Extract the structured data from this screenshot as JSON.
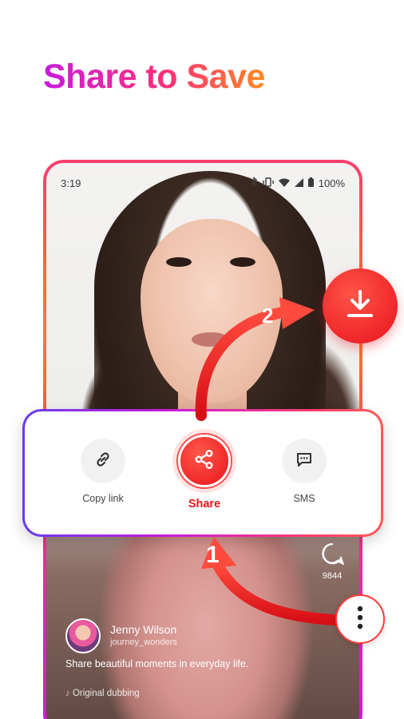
{
  "headline": "Share to Save",
  "status_bar": {
    "time": "3:19",
    "battery": "100%",
    "icons": [
      "bluetooth-icon",
      "vibrate-icon",
      "wifi-icon",
      "signal-icon",
      "battery-icon"
    ]
  },
  "video": {
    "comment_count": "9844",
    "user_name": "Jenny Wilson",
    "user_handle": "journey_wonders",
    "caption": "Share beautiful moments in everyday life.",
    "music": "Original dubbing"
  },
  "share_sheet": {
    "copy_link_label": "Copy link",
    "share_label": "Share",
    "sms_label": "SMS"
  },
  "steps": {
    "step1": "1",
    "step2": "2"
  },
  "colors": {
    "accent_red": "#e8111c",
    "gradient_start": "#c81bdc",
    "gradient_end": "#ff8a1f"
  }
}
